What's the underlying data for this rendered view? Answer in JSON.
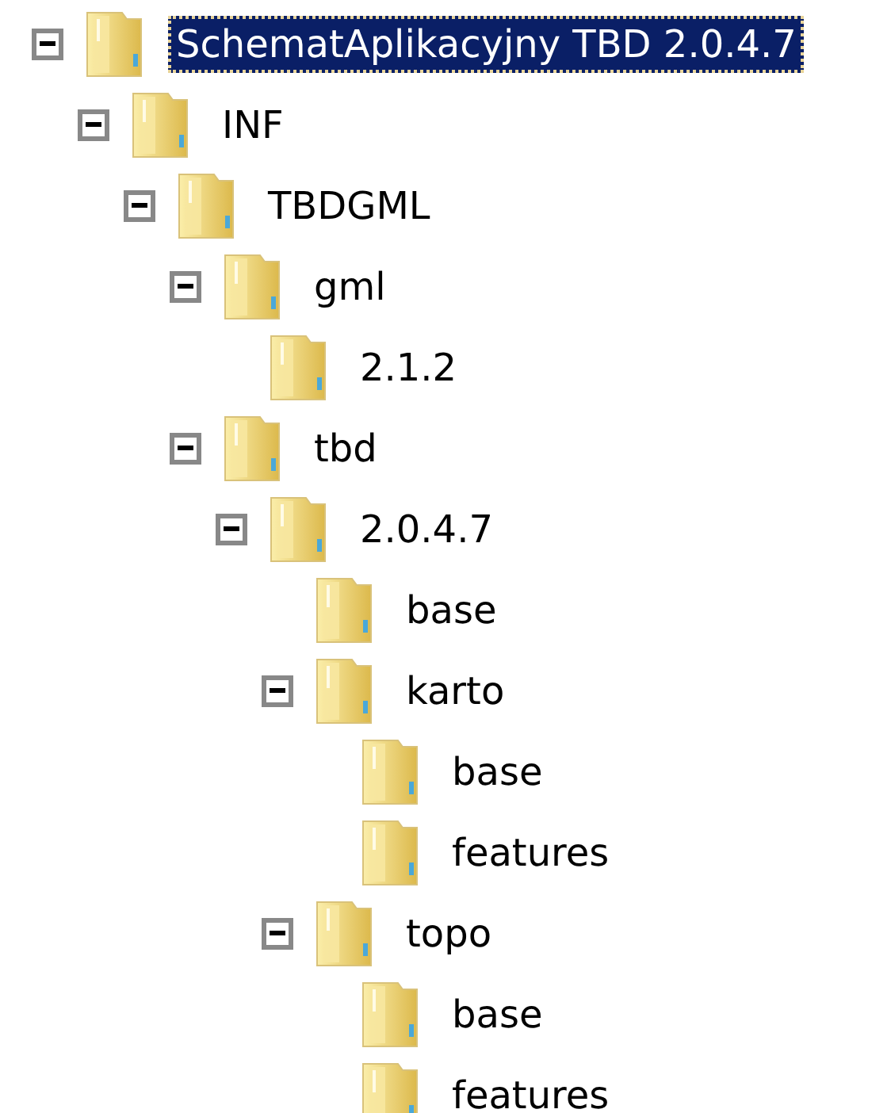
{
  "tree": [
    {
      "label": "SchematAplikacyjny TBD 2.0.4.7",
      "selected": true,
      "expanded": true,
      "children": [
        {
          "label": "INF",
          "selected": false,
          "expanded": true,
          "children": [
            {
              "label": "TBDGML",
              "selected": false,
              "expanded": true,
              "children": [
                {
                  "label": "gml",
                  "selected": false,
                  "expanded": true,
                  "children": [
                    {
                      "label": "2.1.2",
                      "selected": false
                    }
                  ]
                },
                {
                  "label": "tbd",
                  "selected": false,
                  "expanded": true,
                  "children": [
                    {
                      "label": "2.0.4.7",
                      "selected": false,
                      "expanded": true,
                      "children": [
                        {
                          "label": "base",
                          "selected": false
                        },
                        {
                          "label": "karto",
                          "selected": false,
                          "expanded": true,
                          "children": [
                            {
                              "label": "base",
                              "selected": false
                            },
                            {
                              "label": "features",
                              "selected": false
                            }
                          ]
                        },
                        {
                          "label": "topo",
                          "selected": false,
                          "expanded": true,
                          "children": [
                            {
                              "label": "base",
                              "selected": false
                            },
                            {
                              "label": "features",
                              "selected": false
                            }
                          ]
                        }
                      ]
                    }
                  ]
                }
              ]
            }
          ]
        }
      ]
    }
  ]
}
